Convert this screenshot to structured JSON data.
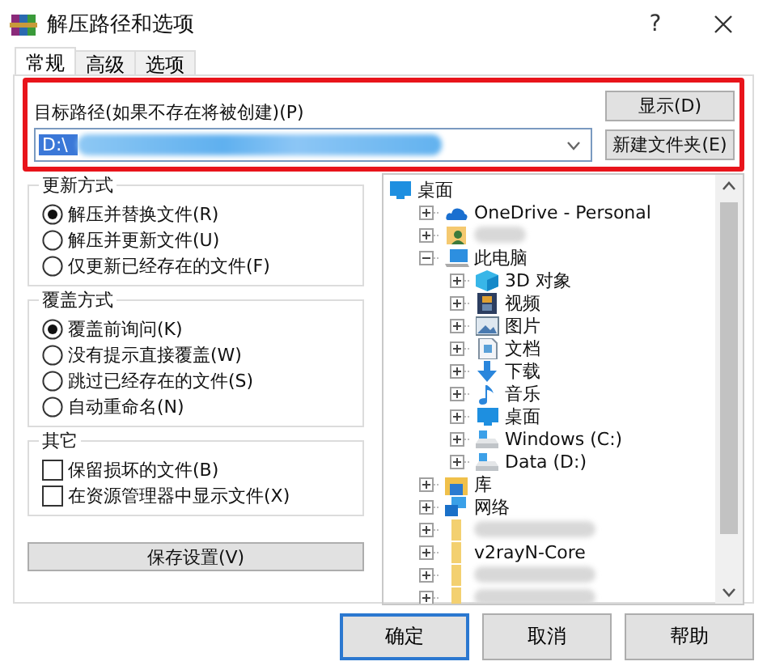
{
  "window": {
    "title": "解压路径和选项",
    "help_button": "?"
  },
  "tabs": [
    {
      "label": "常规",
      "selected": true
    },
    {
      "label": "高级",
      "selected": false
    },
    {
      "label": "选项",
      "selected": false
    }
  ],
  "destination": {
    "label": "目标路径(如果不存在将被创建)(P)",
    "value": "D:\\",
    "redacted": true,
    "highlighted": true,
    "buttons": [
      "显示(D)",
      "新建文件夹(E)"
    ]
  },
  "update_mode": {
    "title": "更新方式",
    "options": [
      {
        "label": "解压并替换文件(R)",
        "selected": true
      },
      {
        "label": "解压并更新文件(U)",
        "selected": false
      },
      {
        "label": "仅更新已经存在的文件(F)",
        "selected": false
      }
    ]
  },
  "overwrite_mode": {
    "title": "覆盖方式",
    "options": [
      {
        "label": "覆盖前询问(K)",
        "selected": true
      },
      {
        "label": "没有提示直接覆盖(W)",
        "selected": false
      },
      {
        "label": "跳过已经存在的文件(S)",
        "selected": false
      },
      {
        "label": "自动重命名(N)",
        "selected": false
      }
    ]
  },
  "other": {
    "title": "其它",
    "options": [
      {
        "label": "保留损坏的文件(B)",
        "checked": false
      },
      {
        "label": "在资源管理器中显示文件(X)",
        "checked": false
      }
    ]
  },
  "save_button": "保存设置(V)",
  "tree": {
    "label": "桌面",
    "kind": "desktop",
    "children": [
      {
        "label": "OneDrive - Personal",
        "kind": "cloud",
        "expanded": false
      },
      {
        "kind": "user",
        "redacted": true,
        "expanded": false
      },
      {
        "label": "此电脑",
        "kind": "computer",
        "expanded": true,
        "children": [
          {
            "label": "3D 对象",
            "kind": "cube",
            "expanded": false
          },
          {
            "label": "视频",
            "kind": "video",
            "expanded": false
          },
          {
            "label": "图片",
            "kind": "image",
            "expanded": false
          },
          {
            "label": "文档",
            "kind": "document",
            "expanded": false
          },
          {
            "label": "下载",
            "kind": "download",
            "expanded": false
          },
          {
            "label": "音乐",
            "kind": "music",
            "expanded": false
          },
          {
            "label": "桌面",
            "kind": "desktop",
            "expanded": false
          },
          {
            "label": "Windows (C:)",
            "kind": "drive",
            "expanded": false
          },
          {
            "label": "Data (D:)",
            "kind": "drive",
            "expanded": false
          }
        ]
      },
      {
        "label": "库",
        "kind": "library",
        "expanded": false
      },
      {
        "label": "网络",
        "kind": "network",
        "expanded": false
      },
      {
        "kind": "folder",
        "redacted": true,
        "expanded": false
      },
      {
        "label": "v2rayN-Core",
        "kind": "folder",
        "expanded": false
      },
      {
        "kind": "folder",
        "redacted": true,
        "expanded": false
      },
      {
        "kind": "folder",
        "redacted": true,
        "expanded": false
      }
    ]
  },
  "footer_buttons": [
    {
      "label": "确定",
      "default": true
    },
    {
      "label": "取消",
      "default": false
    },
    {
      "label": "帮助",
      "default": false
    }
  ]
}
